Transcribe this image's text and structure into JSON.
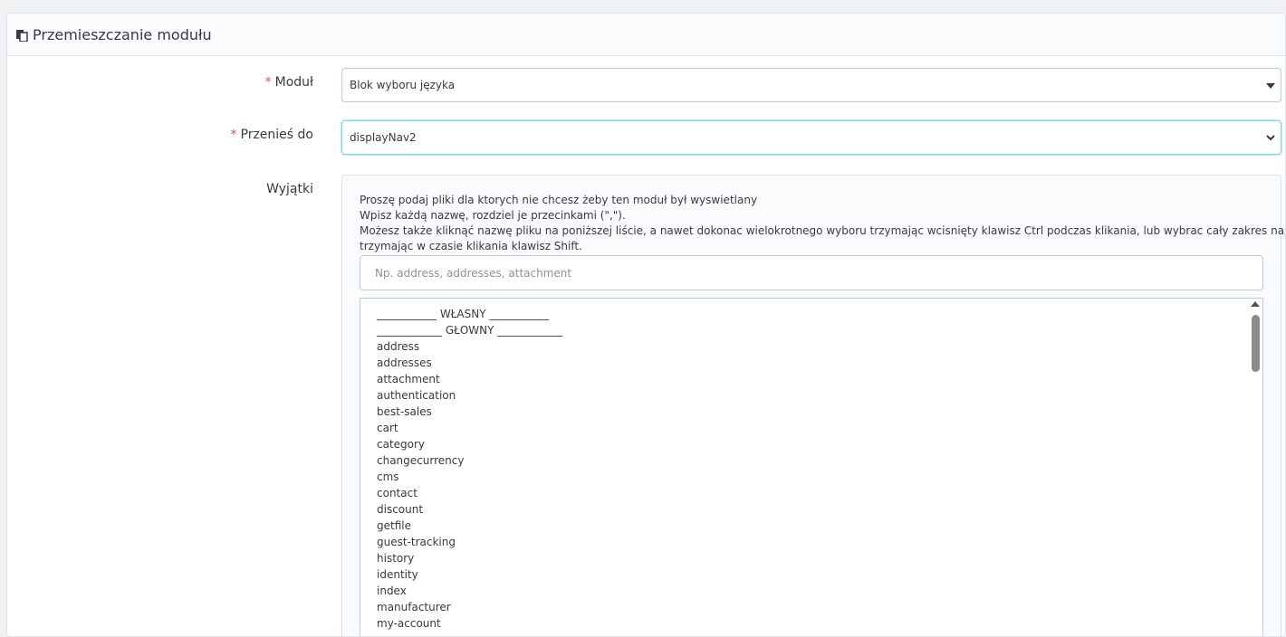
{
  "panel": {
    "title": "Przemieszczanie modułu",
    "icon": "copy-icon"
  },
  "form": {
    "required_mark": "*",
    "module": {
      "label": "Moduł",
      "value": "Blok wyboru języka"
    },
    "move_to": {
      "label": "Przenieś do",
      "value": "displayNav2"
    },
    "exceptions": {
      "label": "Wyjątki",
      "desc_line1": "Proszę podaj pliki dla ktorych nie chcesz żeby ten moduł był wyswietlany",
      "desc_line2": "Wpisz każdą nazwę, rozdziel je przecinkami (\",\").",
      "desc_line3": "Możesz także kliknąć nazwę pliku na poniższej liście, a nawet dokonac wielokrotnego wyboru trzymając wcisnięty klawisz Ctrl podczas klikania, lub wybrac cały zakres nazw plików",
      "desc_line4": "trzymając w czasie klikania klawisz Shift.",
      "input_placeholder": "Np. address, addresses, attachment",
      "list": [
        "___________ WŁASNY ___________",
        "____________ GŁOWNY ____________",
        "address",
        "addresses",
        "attachment",
        "authentication",
        "best-sales",
        "cart",
        "category",
        "changecurrency",
        "cms",
        "contact",
        "discount",
        "getfile",
        "guest-tracking",
        "history",
        "identity",
        "index",
        "manufacturer",
        "my-account"
      ]
    }
  },
  "colors": {
    "required": "#c05c67",
    "focus_border": "#7cd5e7"
  }
}
